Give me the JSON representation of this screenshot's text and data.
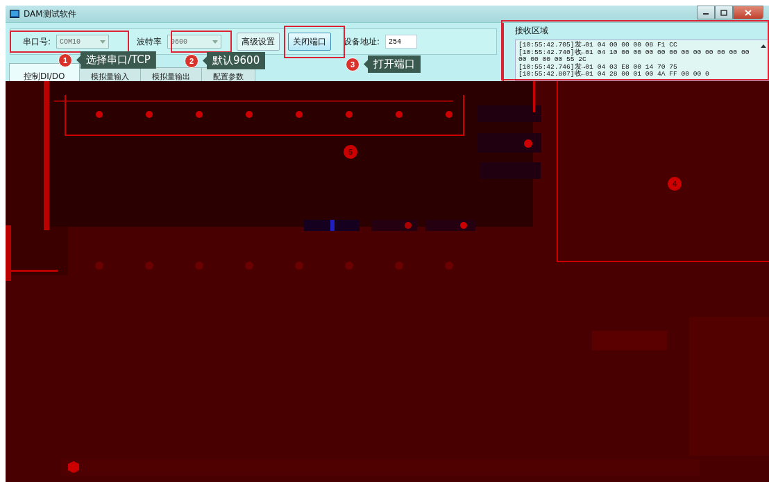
{
  "window": {
    "title": "DAM测试软件"
  },
  "port": {
    "label": "串口号:",
    "value": "COM10"
  },
  "baud": {
    "label": "波特率",
    "value": "9600"
  },
  "buttons": [
    {
      "label": "高级设置",
      "kind": "plain"
    },
    {
      "label": "关闭端口",
      "kind": "active"
    }
  ],
  "address": {
    "label": "设备地址:",
    "value": "254"
  },
  "tabs": [
    {
      "label": "控制DI/DO",
      "selected": true
    },
    {
      "label": "模拟量输入",
      "selected": false
    },
    {
      "label": "模拟量输出",
      "selected": false
    },
    {
      "label": "配置参数",
      "selected": false
    }
  ],
  "receive": {
    "title": "接收区域",
    "log": [
      "[10:55:42.705]发→01 04 00 00 00 08 F1 CC",
      "[10:55:42.740]收←01 04 10 00 00 00 00 00 00 00 00 00 00 00 00 00 00 00 55 2C",
      "[10:55:42.746]发→01 04 03 E8 00 14 70 75",
      "[10:55:42.807]收←01 04 28 00 01 00 4A FF 00 00 0"
    ]
  },
  "callouts": [
    {
      "number": "1",
      "text": "选择串口/TCP"
    },
    {
      "number": "2",
      "text": "默认9600"
    },
    {
      "number": "3",
      "text": "打开端口"
    }
  ],
  "markers": [
    {
      "number": "5"
    },
    {
      "number": "4"
    }
  ]
}
